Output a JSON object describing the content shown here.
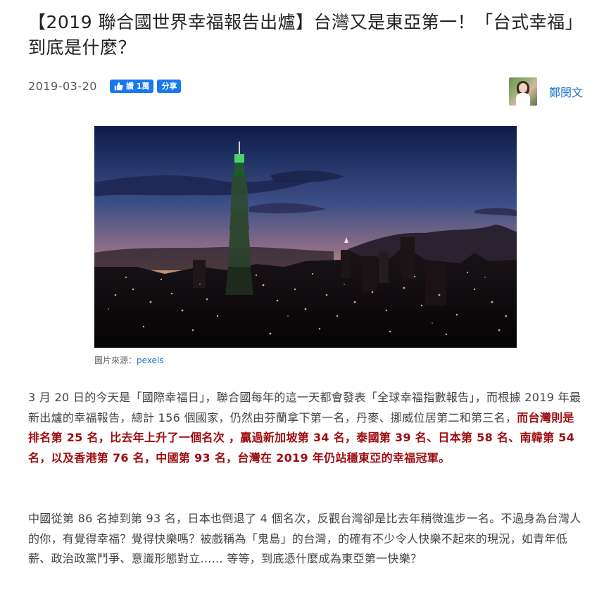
{
  "article": {
    "title": "【2019 聯合國世界幸福報告出爐】台灣又是東亞第一！「台式幸福」到底是什麼？",
    "date": "2019-03-20",
    "like_label": "讚 1萬",
    "share_label": "分享",
    "author": "鄭閔文",
    "image": {
      "credit_prefix": "圖片來源：",
      "credit_link": "pexels"
    },
    "p1_normal": "3 月 20 日的今天是「國際幸福日」，聯合國每年的這一天都會發表「全球幸福指數報告」，而根據 2019 年最新出爐的幸福報告，總計 156 個國家，仍然由芬蘭拿下第一名，丹麥、挪威位居第二和第三名，",
    "p1_highlight": "而台灣則是排名第 25 名，比去年上升了一個名次 ，贏過新加坡第 34 名，泰國第 39 名、日本第 58 名、南韓第 54 名，以及香港第 76 名，中國第 93 名，台灣在 2019 年仍站穩東亞的幸福冠軍。",
    "p2": "中國從第 86 名掉到第 93 名，日本也倒退了 4 個名次，反觀台灣卻是比去年稍微進步一名。不過身為台灣人的你，有覺得幸福？覺得快樂嗎？被戲稱為「鬼島」的台灣，的確有不少令人快樂不起來的現況，如青年低薪、政治政黨鬥爭、意識形態對立...... 等等，到底憑什麼成為東亞第一快樂？"
  },
  "colors": {
    "highlight": "#9e0b0f",
    "link": "#1a73c9",
    "facebook": "#1877f2"
  }
}
